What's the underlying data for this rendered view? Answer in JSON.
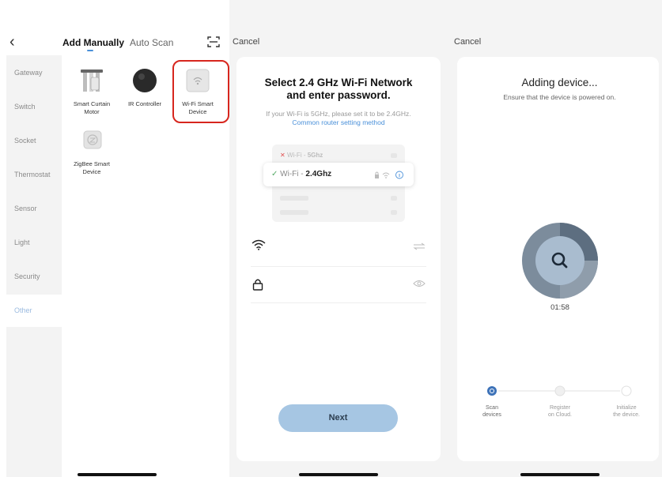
{
  "panel1": {
    "back_icon": "chevron-left-icon",
    "tab_manual": "Add Manually",
    "tab_auto": "Auto Scan",
    "scan_icon": "scan-frame-icon",
    "categories": [
      "Gateway",
      "Switch",
      "Socket",
      "Thermostat",
      "Sensor",
      "Light",
      "Security",
      "Other"
    ],
    "active_category": "Other",
    "devices": [
      {
        "line1": "Smart Curtain",
        "line2": "Motor"
      },
      {
        "line1": "IR Controller",
        "line2": ""
      },
      {
        "line1": "Wi-Fi Smart",
        "line2": "Device"
      },
      {
        "line1": "ZigBee Smart",
        "line2": "Device"
      }
    ],
    "highlight_color": "#d7261e"
  },
  "panel2": {
    "cancel": "Cancel",
    "title_line1": "Select 2.4 GHz Wi-Fi Network",
    "title_line2": "and enter password.",
    "subtitle": "If your Wi-Fi is 5GHz, please set it to be 2.4GHz.",
    "link": "Common router setting method",
    "wifi_5_prefix": "Wi-Fi - ",
    "wifi_5_band": "5Ghz",
    "wifi_24_prefix": "Wi-Fi - ",
    "wifi_24_band": "2.4Ghz",
    "next": "Next",
    "accent": "#4a90d9",
    "button_color": "#a6c6e3"
  },
  "panel3": {
    "cancel": "Cancel",
    "title": "Adding device...",
    "subtitle": "Ensure that the device is powered on.",
    "timer": "01:58",
    "progress_fraction": 0.25,
    "steps": [
      {
        "line1": "Scan",
        "line2": "devices"
      },
      {
        "line1": "Register",
        "line2": "on Cloud."
      },
      {
        "line1": "Initialize",
        "line2": "the device."
      }
    ]
  }
}
